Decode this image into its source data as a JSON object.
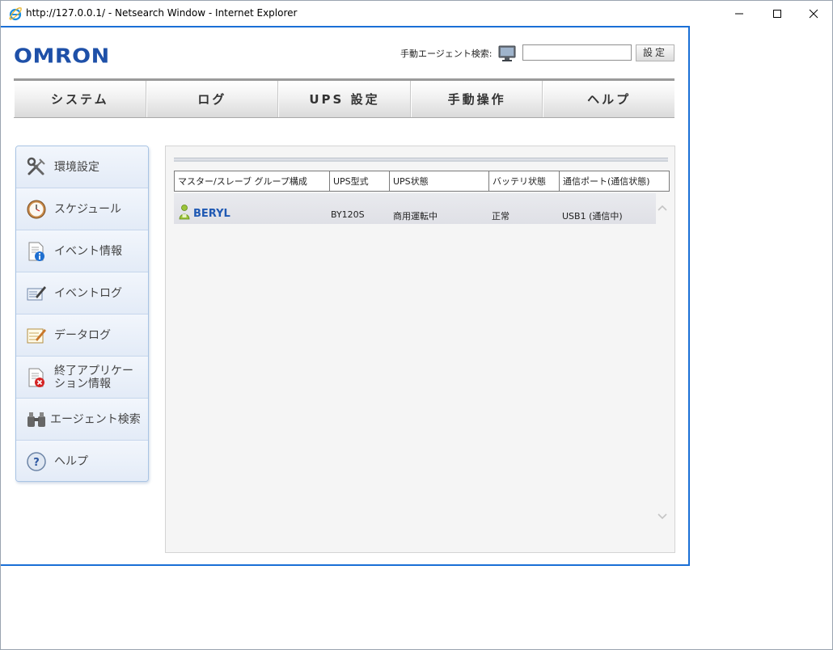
{
  "window": {
    "title": "http://127.0.0.1/ - Netsearch Window - Internet Explorer"
  },
  "header": {
    "logo": "OMRON",
    "search_label": "手動エージェント検索:",
    "search_value": "",
    "set_button": "設定"
  },
  "nav": {
    "items": [
      "システム",
      "ログ",
      "UPS 設定",
      "手動操作",
      "ヘルプ"
    ]
  },
  "sidebar": {
    "items": [
      {
        "label": "環境設定",
        "icon": "tools-icon"
      },
      {
        "label": "スケジュール",
        "icon": "clock-icon"
      },
      {
        "label": "イベント情報",
        "icon": "info-document-icon"
      },
      {
        "label": "イベントログ",
        "icon": "log-pen-icon"
      },
      {
        "label": "データログ",
        "icon": "data-pen-icon"
      },
      {
        "label": "終了アプリケーション情報",
        "label_line1": "終了アプリケー",
        "label_line2": "ション情報",
        "icon": "close-document-icon"
      },
      {
        "label": "エージェント検索",
        "icon": "binoculars-icon"
      },
      {
        "label": "ヘルプ",
        "icon": "help-icon"
      }
    ]
  },
  "table": {
    "headers": [
      "マスター/スレーブ グループ構成",
      "UPS型式",
      "UPS状態",
      "バッテリ状態",
      "通信ポート(通信状態)"
    ],
    "rows": [
      {
        "name": "BERYL",
        "model": "BY120S",
        "ups_status": "商用運転中",
        "battery": "正常",
        "port": "USB1 (通信中)"
      }
    ]
  },
  "colors": {
    "accent": "#1a6fd6",
    "logo": "#1e50a8",
    "link": "#1f59b3"
  }
}
